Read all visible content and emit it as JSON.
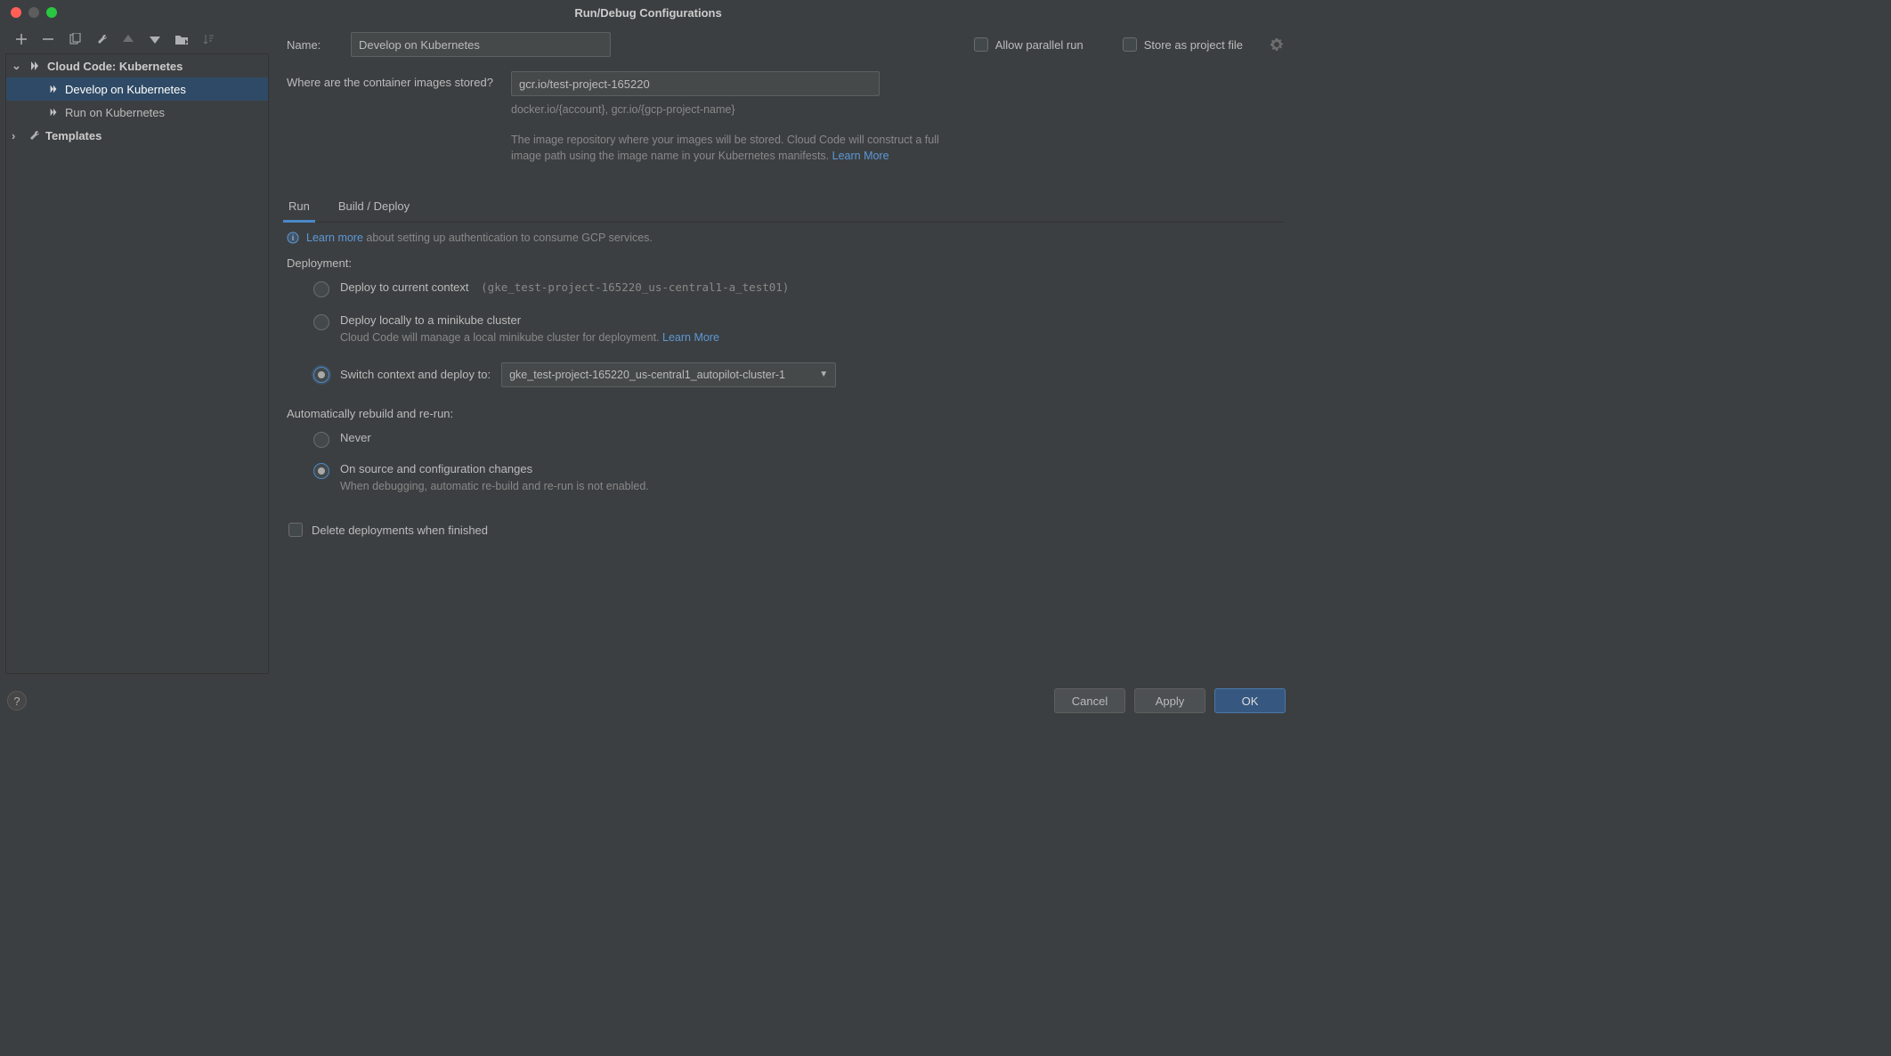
{
  "window": {
    "title": "Run/Debug Configurations"
  },
  "tree": {
    "root": "Cloud Code: Kubernetes",
    "items": [
      "Develop on Kubernetes",
      "Run on Kubernetes"
    ],
    "templates": "Templates"
  },
  "form": {
    "name_label": "Name:",
    "name_value": "Develop on Kubernetes",
    "allow_parallel": "Allow parallel run",
    "store_project": "Store as project file",
    "image_label": "Where are the container images stored?",
    "image_value": "gcr.io/test-project-165220",
    "image_hint": "docker.io/{account}, gcr.io/{gcp-project-name}",
    "image_desc": "The image repository where your images will be stored. Cloud Code will construct a full image path using the image name in your Kubernetes manifests. ",
    "image_learn": "Learn More"
  },
  "tabs": {
    "run": "Run",
    "build": "Build / Deploy"
  },
  "info": {
    "learn_more": "Learn more",
    "rest": " about setting up authentication to consume GCP services."
  },
  "deployment": {
    "label": "Deployment:",
    "opt1": "Deploy to current context",
    "opt1_ctx": "(gke_test-project-165220_us-central1-a_test01)",
    "opt2": "Deploy locally to a minikube cluster",
    "opt2_sub_prefix": "Cloud Code will manage a local minikube cluster for deployment. ",
    "opt2_learn": "Learn More",
    "opt3": "Switch context and deploy to:",
    "opt3_value": "gke_test-project-165220_us-central1_autopilot-cluster-1"
  },
  "rebuild": {
    "label": "Automatically rebuild and re-run:",
    "never": "Never",
    "on_change": "On source and configuration changes",
    "on_change_sub": "When debugging, automatic re-build and re-run is not enabled."
  },
  "delete_deploy": "Delete deployments when finished",
  "buttons": {
    "cancel": "Cancel",
    "apply": "Apply",
    "ok": "OK"
  }
}
